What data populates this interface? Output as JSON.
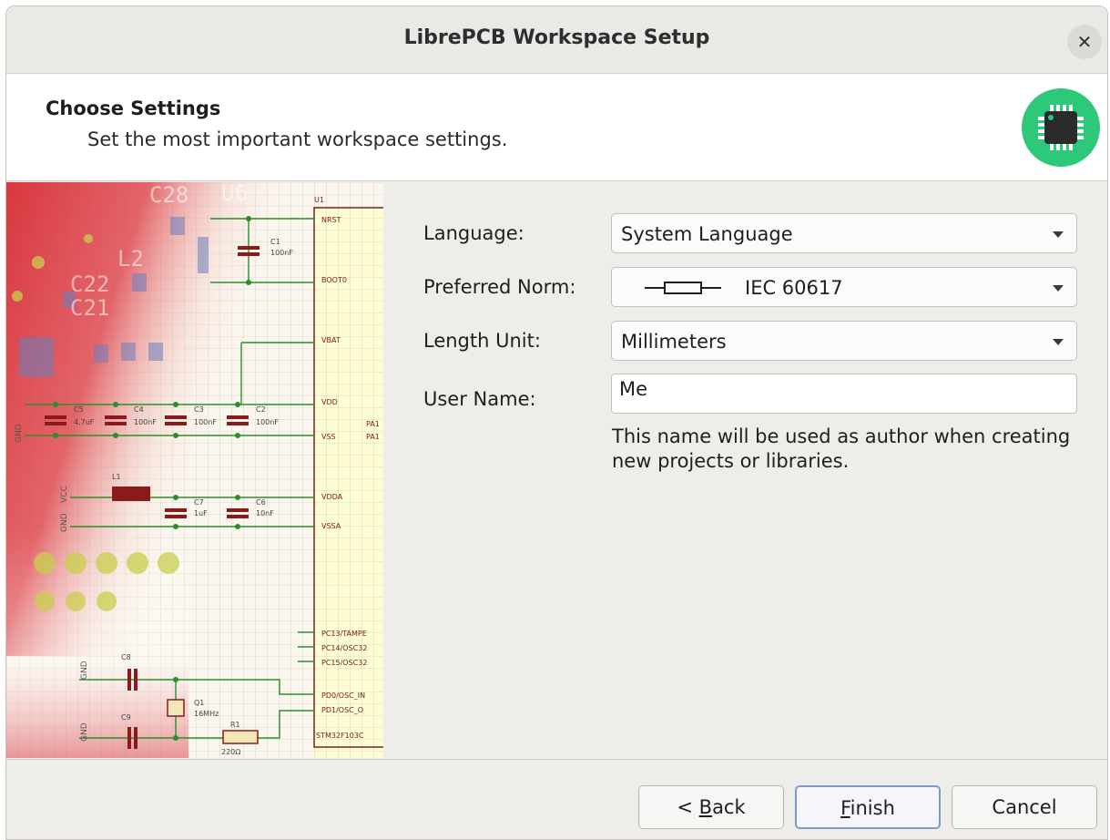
{
  "window": {
    "title": "LibrePCB Workspace Setup"
  },
  "header": {
    "title": "Choose Settings",
    "subtitle": "Set the most important workspace settings.",
    "logo_icon": "chip-icon",
    "logo_color": "#2dc879"
  },
  "form": {
    "language_label": "Language:",
    "language_value": "System Language",
    "norm_label": "Preferred Norm:",
    "norm_value": "IEC 60617",
    "unit_label": "Length Unit:",
    "unit_value": "Millimeters",
    "username_label": "User Name:",
    "username_value": "Me",
    "hint": "This name will be used as author when creating new projects or libraries."
  },
  "schematic": {
    "ic_name": "U1",
    "ic_part": "STM32F103C",
    "pins": [
      "NRST",
      "BOOT0",
      "VBAT",
      "VDD",
      "VSS",
      "VDDA",
      "VSSA",
      "PC13/TAMPE",
      "PC14/OSC32",
      "PC15/OSC32",
      "PD0/OSC_IN",
      "PD1/OSC_O"
    ],
    "pcb_labels": [
      "C28",
      "U6",
      "C22",
      "C21",
      "L2"
    ],
    "components": [
      "C1",
      "C2",
      "C3",
      "C4",
      "C5",
      "C6",
      "C7",
      "C8",
      "C9",
      "L1",
      "Q1",
      "R1"
    ]
  },
  "buttons": {
    "back_prefix": "< ",
    "back_key": "B",
    "back_rest": "ack",
    "finish_key": "F",
    "finish_rest": "inish",
    "cancel": "Cancel"
  }
}
